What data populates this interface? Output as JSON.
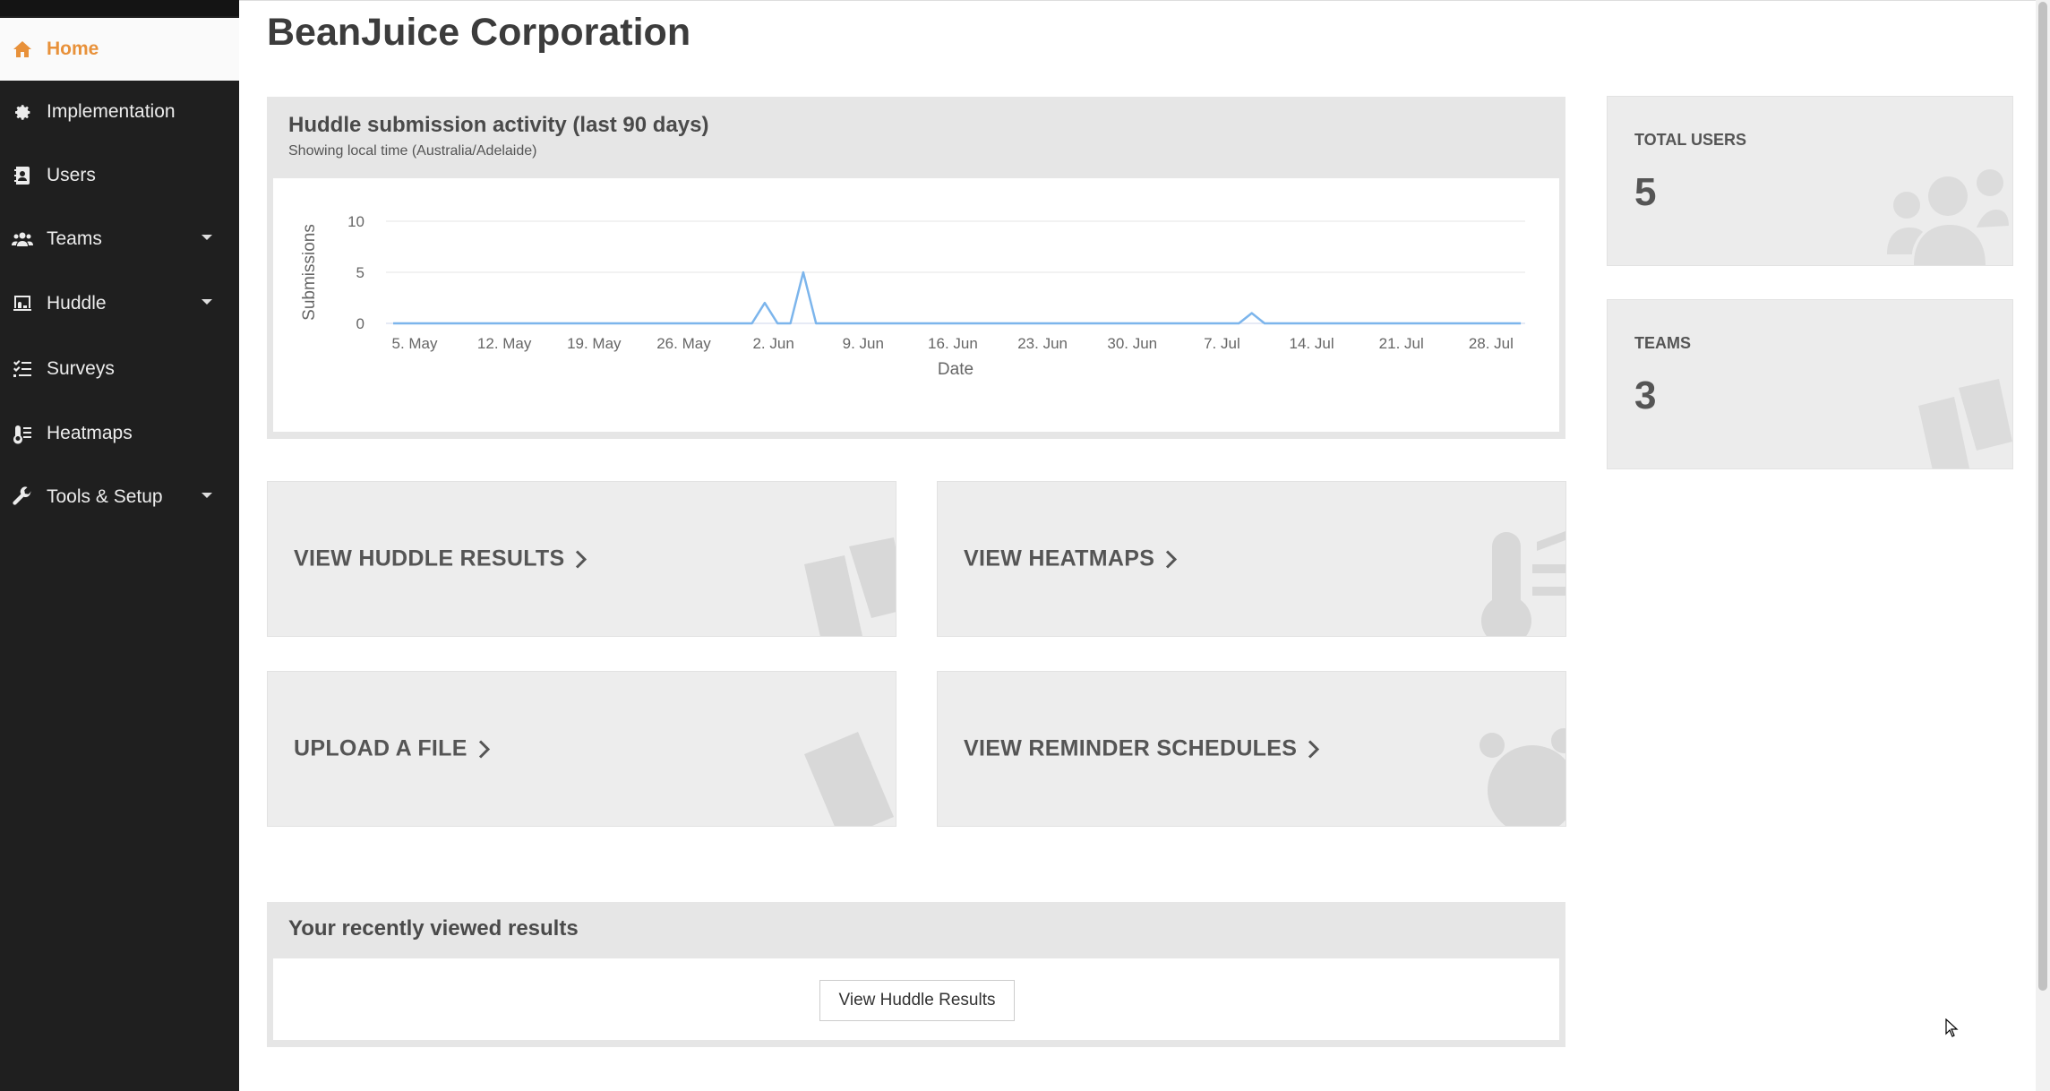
{
  "sidebar": {
    "items": [
      {
        "label": "Home",
        "icon": "home-icon",
        "active": true
      },
      {
        "label": "Implementation",
        "icon": "gear-icon"
      },
      {
        "label": "Users",
        "icon": "address-book-icon"
      },
      {
        "label": "Teams",
        "icon": "users-icon",
        "dropdown": true
      },
      {
        "label": "Huddle",
        "icon": "chalkboard-icon",
        "dropdown": true
      },
      {
        "label": "Surveys",
        "icon": "list-check-icon"
      },
      {
        "label": "Heatmaps",
        "icon": "thermometer-icon"
      },
      {
        "label": "Tools & Setup",
        "icon": "wrench-icon",
        "dropdown": true
      }
    ]
  },
  "page": {
    "title": "BeanJuice Corporation"
  },
  "activity_panel": {
    "title": "Huddle submission activity (last 90 days)",
    "subtitle": "Showing local time (Australia/Adelaide)"
  },
  "chart_data": {
    "type": "line",
    "xlabel": "Date",
    "ylabel": "Submissions",
    "ylim": [
      0,
      10
    ],
    "yticks": [
      0,
      5,
      10
    ],
    "x_tick_labels": [
      "5. May",
      "12. May",
      "19. May",
      "26. May",
      "2. Jun",
      "9. Jun",
      "16. Jun",
      "23. Jun",
      "30. Jun",
      "7. Jul",
      "14. Jul",
      "21. Jul",
      "28. Jul"
    ],
    "grid": true,
    "legend": "none",
    "color": "#7cb5ec",
    "series": [
      {
        "points": [
          [
            "2024-05-05",
            0
          ],
          [
            "2024-06-01",
            0
          ],
          [
            "2024-06-02",
            0
          ],
          [
            "2024-06-03",
            2
          ],
          [
            "2024-06-04",
            0
          ],
          [
            "2024-06-05",
            0
          ],
          [
            "2024-06-06",
            5
          ],
          [
            "2024-06-07",
            0
          ],
          [
            "2024-07-10",
            0
          ],
          [
            "2024-07-11",
            1
          ],
          [
            "2024-07-12",
            0
          ],
          [
            "2024-08-01",
            0
          ]
        ]
      }
    ]
  },
  "actions": {
    "huddle_results": "VIEW HUDDLE RESULTS",
    "heatmaps": "VIEW HEATMAPS",
    "upload": "UPLOAD A FILE",
    "reminders": "VIEW REMINDER SCHEDULES"
  },
  "stats": {
    "users": {
      "label": "TOTAL USERS",
      "value": "5"
    },
    "teams": {
      "label": "TEAMS",
      "value": "3"
    }
  },
  "recent": {
    "title": "Your recently viewed results",
    "button": "View Huddle Results"
  }
}
